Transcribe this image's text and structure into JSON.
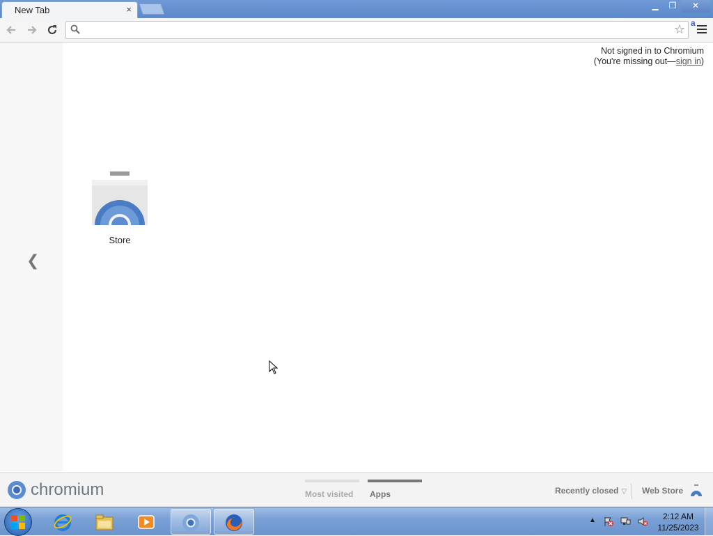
{
  "browser": {
    "tab_title": "New Tab",
    "tab_close_glyph": "×",
    "window_controls": {
      "minimize": "▁",
      "maximize": "❐",
      "close": "✕"
    }
  },
  "toolbar": {
    "omnibox_value": "",
    "extension_badge": "a"
  },
  "signin": {
    "line1": "Not signed in to Chromium",
    "line2_prefix": "(You're missing out—",
    "link": "sign in",
    "line2_suffix": ")"
  },
  "apps": [
    {
      "label": "Store",
      "icon": "chrome-web-store-icon"
    }
  ],
  "footer": {
    "brand": "chromium",
    "pages": [
      {
        "label": "Most visited",
        "active": false
      },
      {
        "label": "Apps",
        "active": true
      }
    ],
    "recently_closed": "Recently closed",
    "web_store": "Web Store"
  },
  "taskbar": {
    "items": [
      "internet-explorer-icon",
      "windows-explorer-icon",
      "media-player-icon",
      "chromium-icon",
      "firefox-icon"
    ],
    "clock_time": "2:12 AM",
    "clock_date": "11/25/2023"
  },
  "colors": {
    "titlebar": "#5b88c9",
    "taskbar": "#7aa1d6",
    "chromium_blue": "#4a7cc3"
  }
}
